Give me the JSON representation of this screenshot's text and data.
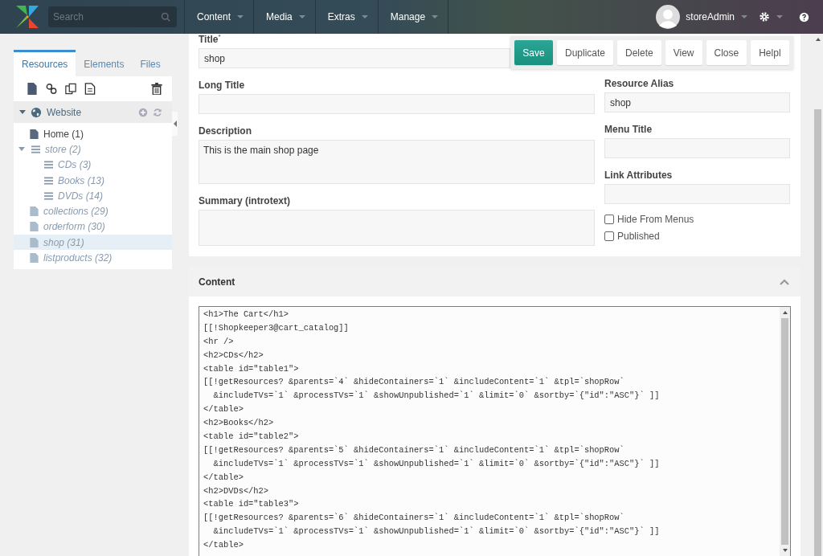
{
  "topbar": {
    "search": {
      "placeholder": "Search"
    },
    "menu": [
      {
        "label": "Content"
      },
      {
        "label": "Media"
      },
      {
        "label": "Extras"
      },
      {
        "label": "Manage"
      }
    ],
    "user": "storeAdmin"
  },
  "sidebar": {
    "tabs": [
      {
        "label": "Resources",
        "selected": true
      },
      {
        "label": "Elements",
        "selected": false
      },
      {
        "label": "Files",
        "selected": false
      }
    ],
    "root": {
      "label": "Website",
      "expanded": true
    },
    "tree": [
      {
        "label": "Home (1)",
        "kind": "document",
        "published": true,
        "selected": false
      },
      {
        "label": "store (2)",
        "kind": "container",
        "published": false,
        "selected": false,
        "expanded": true,
        "children": [
          {
            "label": "CDs (3)",
            "kind": "container",
            "published": false,
            "selected": false
          },
          {
            "label": "Books (13)",
            "kind": "container",
            "published": false,
            "selected": false
          },
          {
            "label": "DVDs (14)",
            "kind": "container",
            "published": false,
            "selected": false
          }
        ]
      },
      {
        "label": "collections (29)",
        "kind": "document",
        "published": false,
        "selected": false
      },
      {
        "label": "orderform (30)",
        "kind": "document",
        "published": false,
        "selected": false
      },
      {
        "label": "shop (31)",
        "kind": "document",
        "published": false,
        "selected": true
      },
      {
        "label": "listproducts (32)",
        "kind": "document",
        "published": false,
        "selected": false
      }
    ]
  },
  "toolbar": [
    {
      "label": "Save",
      "primary": true
    },
    {
      "label": "Duplicate",
      "primary": false
    },
    {
      "label": "Delete",
      "primary": false
    },
    {
      "label": "View",
      "primary": false
    },
    {
      "label": "Close",
      "primary": false
    },
    {
      "label": "Helpl",
      "primary": false
    }
  ],
  "form": {
    "left": [
      {
        "label": "Title$^{*}$",
        "value": "shop",
        "kind": "input"
      },
      {
        "label": "Long Title",
        "kind": "input"
      },
      {
        "label": "Description",
        "value": "This is the main shop page",
        "kind": "textarea"
      },
      {
        "label": "Summary (introtext)",
        "kind": "textarea"
      }
    ],
    "right": [
      {
        "label": "Resource Alias",
        "value": "shop"
      },
      {
        "label": "Menu Title"
      },
      {
        "label": "Link Attributes"
      }
    ],
    "checkboxes": [
      {
        "label": "Hide From Menus",
        "checked": false
      },
      {
        "label": "Published",
        "checked": false
      }
    ]
  },
  "content": {
    "title": "Content",
    "expanded": true,
    "lines": [
      "<h1>The Cart</h1>",
      "[[!Shopkeeper3@cart_catalog]]",
      "<hr />",
      "<h2>CDs</h2>",
      "<table id=\"table1\">",
      "[[!getResources? &parents=`4` &hideContainers=`1` &includeContent=`1` &tpl=`shopRow`",
      "  &includeTVs=`1` &processTVs=`1` &showUnpublished=`1` &limit=`0` &sortby=`{\"id\":\"ASC\"}` ]]",
      "</table>",
      "<h2>Books</h2>",
      "<table id=\"table2\">",
      "[[!getResources? &parents=`5` &hideContainers=`1` &includeContent=`1` &tpl=`shopRow`",
      "  &includeTVs=`1` &processTVs=`1` &showUnpublished=`1` &limit=`0` &sortby=`{\"id\":\"ASC\"}` ]]",
      "</table>",
      "<h2>DVDs</h2>",
      "<table id=\"table3\">",
      "[[!getResources? &parents=`6` &hideContainers=`1` &includeContent=`1` &tpl=`shopRow`",
      "  &includeTVs=`1` &processTVs=`1` &showUnpublished=`1` &limit=`0` &sortby=`{\"id\":\"ASC\"}` ]]",
      "</table>"
    ]
  }
}
